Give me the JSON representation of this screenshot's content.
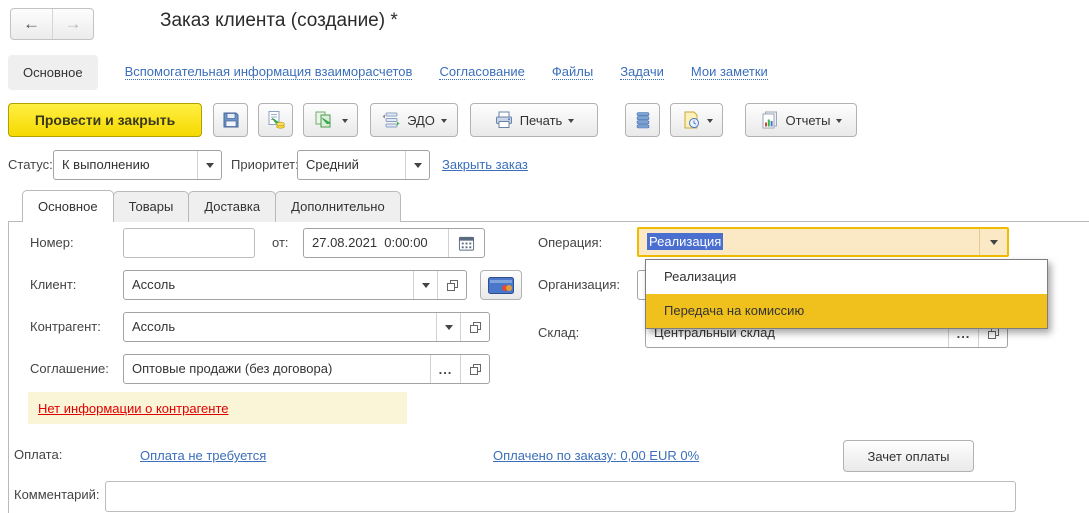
{
  "window": {
    "title": "Заказ клиента (создание) *"
  },
  "glyphs": {
    "back_arrow": "←",
    "forward_arrow": "→",
    "ellipsis": "..."
  },
  "nav": {
    "active_tab": "Основное",
    "links": [
      "Вспомогательная информация взаиморасчетов",
      "Согласование",
      "Файлы",
      "Задачи",
      "Мои заметки"
    ]
  },
  "toolbar": {
    "post_and_close": "Провести и закрыть",
    "edo": "ЭДО",
    "print": "Печать",
    "reports": "Отчеты"
  },
  "status_row": {
    "status_label": "Статус:",
    "status_value": "К выполнению",
    "priority_label": "Приоритет:",
    "priority_value": "Средний",
    "close_order": "Закрыть заказ"
  },
  "form_tabs": {
    "tabs": [
      "Основное",
      "Товары",
      "Доставка",
      "Дополнительно"
    ],
    "active": "Основное"
  },
  "fields": {
    "number_label": "Номер:",
    "number_value": "",
    "date_label": "от:",
    "date_value": "27.08.2021  0:00:00",
    "operation_label": "Операция:",
    "operation_value": "Реализация",
    "client_label": "Клиент:",
    "client_value": "Ассоль",
    "organization_label": "Организация:",
    "counterparty_label": "Контрагент:",
    "counterparty_value": "Ассоль",
    "warehouse_label": "Склад:",
    "warehouse_value": "Центральный склад",
    "agreement_label": "Соглашение:",
    "agreement_value": "Оптовые продажи (без договора)"
  },
  "operation_dropdown": {
    "items": [
      "Реализация",
      "Передача на комиссию"
    ],
    "highlighted_index": 1
  },
  "warning": {
    "text": "Нет информации о контрагенте"
  },
  "payment": {
    "label": "Оплата:",
    "not_required": "Оплата не требуется",
    "paid": "Оплачено по заказу: 0,00 EUR 0%",
    "offset_button": "Зачет оплаты"
  },
  "comment": {
    "label": "Комментарий:",
    "value": ""
  },
  "colors": {
    "accent_yellow": "#f6d900",
    "dropdown_highlight": "#f0c11d",
    "focus_border": "#f0bc00",
    "focus_bg": "#fbe8c5",
    "selection_blue": "#4a6fd0",
    "link_blue": "#3b6fba",
    "error_red": "#e00000",
    "warning_bg": "#fbf5d8"
  }
}
